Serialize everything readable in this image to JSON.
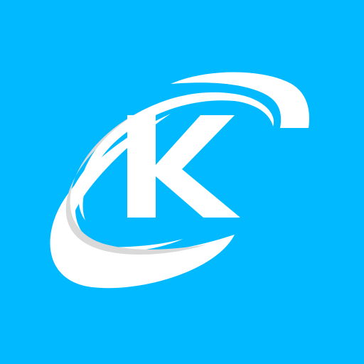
{
  "app_icon": {
    "icon": "k-orbit-logo-icon",
    "letter": "K",
    "colors": {
      "background": "#00B9FF",
      "primary": "#FFFFFF",
      "swoosh_shadow": "#D9D9D9"
    }
  }
}
